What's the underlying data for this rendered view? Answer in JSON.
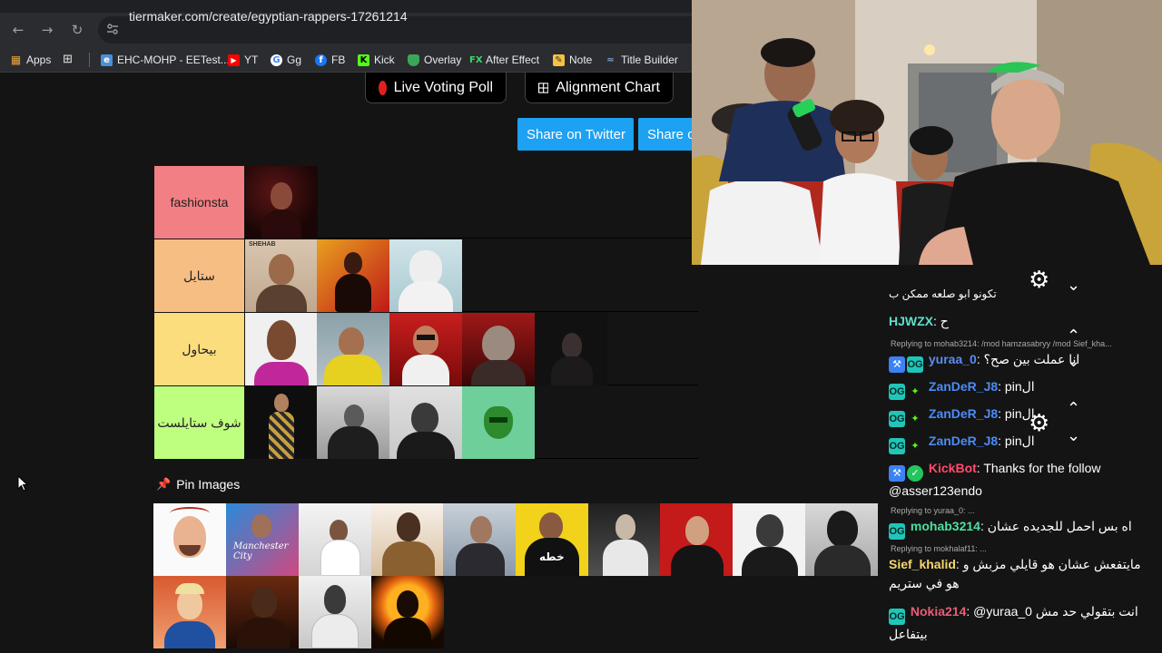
{
  "browser": {
    "url": "tiermaker.com/create/egyptian-rappers-17261214",
    "bookmarks": [
      {
        "label": "Apps",
        "icon": "grid-icon"
      },
      {
        "label": "",
        "icon": "tab-groups-icon"
      },
      {
        "label": "EHC-MOHP - EETest...",
        "icon": "site-icon"
      },
      {
        "label": "YT",
        "icon": "youtube-icon"
      },
      {
        "label": "Gg",
        "icon": "google-icon"
      },
      {
        "label": "FB",
        "icon": "facebook-icon"
      },
      {
        "label": "Kick",
        "icon": "kick-icon"
      },
      {
        "label": "Overlay",
        "icon": "shield-icon"
      },
      {
        "label": "After Effect",
        "icon": "fx-icon"
      },
      {
        "label": "Note",
        "icon": "note-icon"
      },
      {
        "label": "Title Builder",
        "icon": "wave-icon"
      }
    ]
  },
  "page": {
    "live_voting_label": "Live Voting Poll",
    "alignment_label": "Alignment Chart",
    "share_twitter_label": "Share on Twitter",
    "share_other_label": "Share o",
    "pin_label": "Pin Images"
  },
  "tiers": [
    {
      "label": "fashionsta",
      "color": "#f27f83",
      "count": 1
    },
    {
      "label": "ستايل",
      "color": "#f7be84",
      "count": 3
    },
    {
      "label": "بيحاول",
      "color": "#fbdd7e",
      "count": 5
    },
    {
      "label": "شوف ستايلست",
      "color": "#bfff80",
      "count": 4
    }
  ],
  "chat": {
    "messages": [
      {
        "user": "",
        "text": "تكونو ابو صلعه ممكن ب",
        "color": "#ffffff"
      },
      {
        "user": "HJWZX",
        "text": ": ح",
        "color": "#5ce1c8"
      },
      {
        "reply": "Replying to mohab3214: /mod hamzasabryy /mod Sief_kha..."
      },
      {
        "user": "yuraa_0",
        "text": ": انا عملت بين صح؟",
        "color": "#5c8cf0"
      },
      {
        "user": "ZanDeR_J8",
        "text": ": pinال",
        "color": "#4a8cf7"
      },
      {
        "user": "ZanDeR_J8",
        "text": ": pinال",
        "color": "#4a8cf7"
      },
      {
        "user": "ZanDeR_J8",
        "text": ": pinال",
        "color": "#4a8cf7"
      },
      {
        "user": "KickBot",
        "text": ": Thanks for the follow @asser123endo",
        "color": "#ff4b6e"
      },
      {
        "reply": "Replying to yuraa_0: ..."
      },
      {
        "user": "mohab3214",
        "text": ": اه بس احمل للجديده عشان",
        "color": "#4de0a0"
      },
      {
        "reply": "Replying to mokhalaf11: ..."
      },
      {
        "user": "Sief_khalid",
        "text": ": مايتفعش عشان هو قايلي مزبش و هو في ستريم",
        "color": "#f5d76e"
      },
      {
        "user": "Nokia214",
        "text": ": @yuraa_0 انت بتقولي حد مش بيتفاعل",
        "color": "#e85c7a"
      }
    ]
  }
}
